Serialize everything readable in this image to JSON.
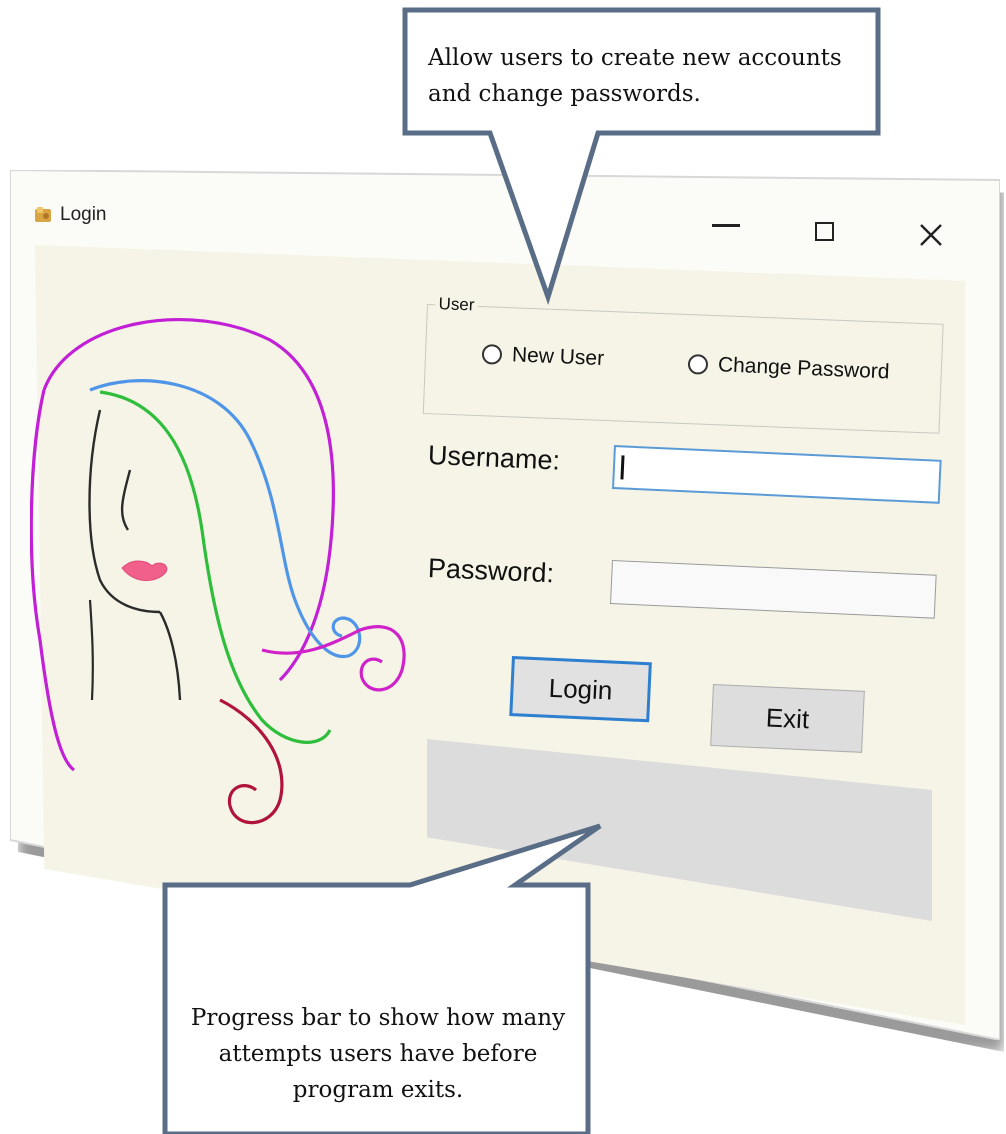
{
  "window": {
    "title": "Login",
    "controls": {
      "minimize": "minimize-icon",
      "maximize": "maximize-icon",
      "close": "close-icon"
    }
  },
  "user_group": {
    "legend": "User",
    "options": [
      {
        "label": "New User",
        "selected": false
      },
      {
        "label": "Change Password",
        "selected": false
      }
    ]
  },
  "form": {
    "username_label": "Username:",
    "username_value": "",
    "password_label": "Password:",
    "password_value": ""
  },
  "buttons": {
    "login": "Login",
    "exit": "Exit"
  },
  "progress": {
    "value": 0
  },
  "callouts": {
    "top": "Allow users to create new accounts and change passwords.",
    "bottom": "Progress bar to show how many attempts users have before program exits."
  },
  "colors": {
    "client_background": "#f5f4e6",
    "focus_border": "#5b9bd5",
    "login_button_border": "#2f7fd0",
    "callout_border": "#5a6d86",
    "progress_background": "#dcdcdc"
  }
}
